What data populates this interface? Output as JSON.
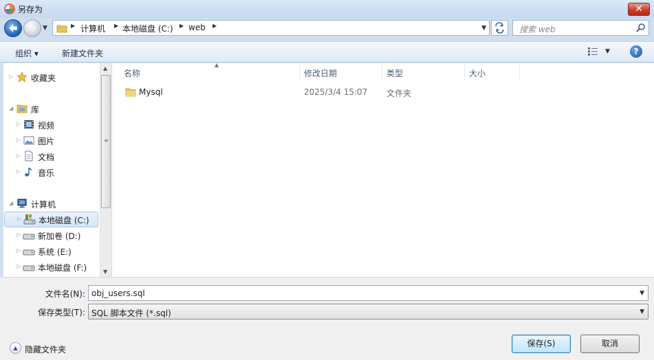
{
  "window": {
    "title": "另存为",
    "close_label": "✕"
  },
  "address": {
    "crumbs": [
      "计算机",
      "本地磁盘 (C:)",
      "web"
    ],
    "search_placeholder": "搜索 web"
  },
  "toolbar": {
    "organize_label": "组织 ▾",
    "new_folder_label": "新建文件夹",
    "help_label": "?"
  },
  "nav": {
    "favorites": "收藏夹",
    "libraries": "库",
    "video": "视频",
    "pictures": "图片",
    "documents": "文档",
    "music": "音乐",
    "computer": "计算机",
    "drive_c": "本地磁盘 (C:)",
    "drive_d": "新加卷 (D:)",
    "drive_e": "系统 (E:)",
    "drive_f": "本地磁盘 (F:)"
  },
  "files": {
    "columns": {
      "name": "名称",
      "date": "修改日期",
      "type": "类型",
      "size": "大小"
    },
    "rows": [
      {
        "name": "Mysql",
        "date": "2025/3/4 15:07",
        "type": "文件夹",
        "size": ""
      }
    ]
  },
  "form": {
    "filename_label": "文件名(N):",
    "filename_value": "obj_users.sql",
    "filetype_label": "保存类型(T):",
    "filetype_value": "SQL 脚本文件 (*.sql)",
    "hide_folders_label": "隐藏文件夹",
    "save_label": "保存(S)",
    "cancel_label": "取消"
  },
  "colors": {
    "accent": "#1f5fb8",
    "frame": "#cfdff0",
    "selection": "#d6e6f7"
  }
}
